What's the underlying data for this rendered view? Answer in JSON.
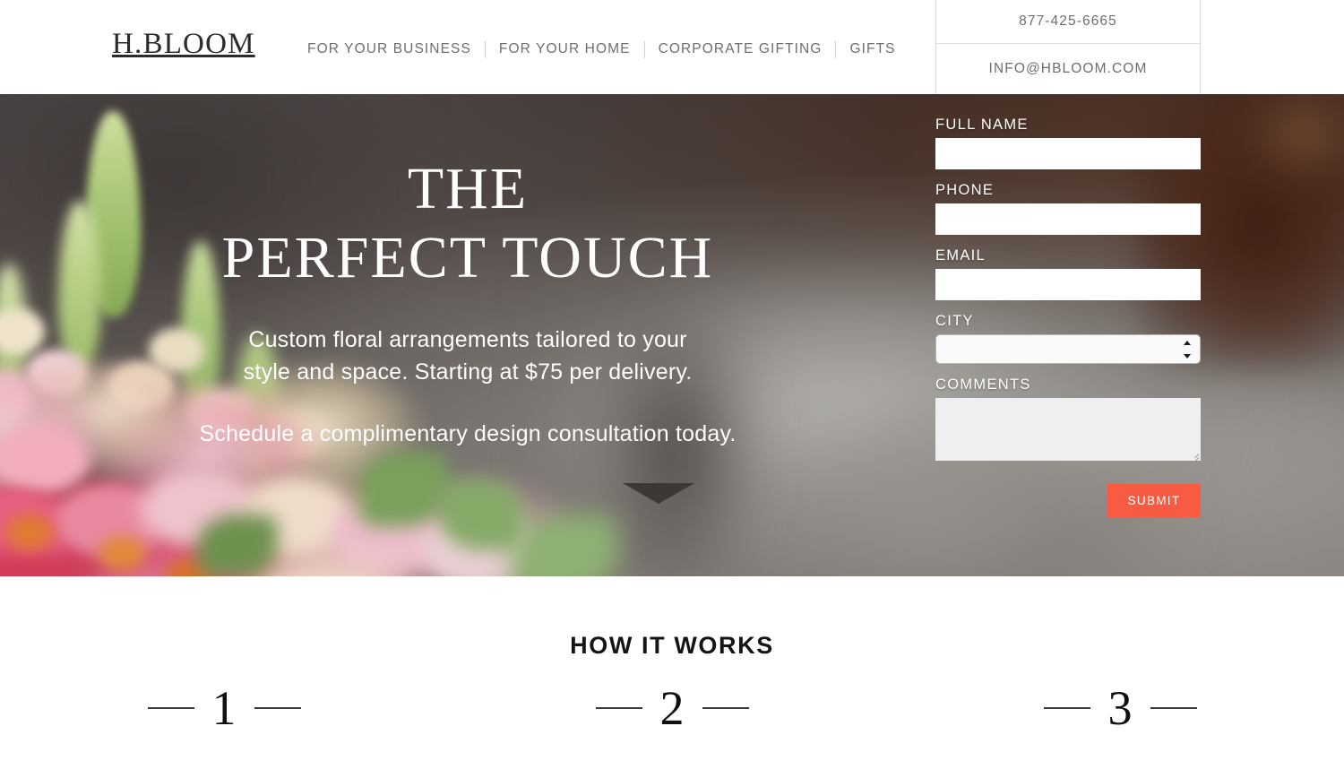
{
  "brand": {
    "logo": "H.BLOOM"
  },
  "nav": {
    "items": [
      {
        "label": "FOR YOUR BUSINESS"
      },
      {
        "label": "FOR YOUR HOME"
      },
      {
        "label": "CORPORATE GIFTING"
      },
      {
        "label": "GIFTS"
      }
    ]
  },
  "contact": {
    "phone": "877-425-6665",
    "email": "INFO@HBLOOM.COM"
  },
  "hero": {
    "title_line1": "THE",
    "title_line2": "PERFECT TOUCH",
    "sub_line1": "Custom floral arrangements tailored to your",
    "sub_line2": "style and space. Starting at $75 per delivery.",
    "cta_line": "Schedule a complimentary design consultation today."
  },
  "form": {
    "fields": [
      {
        "label": "FULL NAME",
        "value": "",
        "placeholder": ""
      },
      {
        "label": "PHONE",
        "value": "",
        "placeholder": ""
      },
      {
        "label": "EMAIL",
        "value": "",
        "placeholder": ""
      }
    ],
    "city": {
      "label": "CITY",
      "selected": "",
      "options": [
        ""
      ]
    },
    "comments": {
      "label": "COMMENTS",
      "value": "",
      "placeholder": ""
    },
    "submit_label": "SUBMIT"
  },
  "how_it_works": {
    "title": "HOW IT WORKS",
    "steps": [
      {
        "number": "1"
      },
      {
        "number": "2"
      },
      {
        "number": "3"
      }
    ]
  },
  "colors": {
    "accent": "#f75c42",
    "nav_text": "#6e6e6e",
    "hero_overlay": "#51494a"
  }
}
